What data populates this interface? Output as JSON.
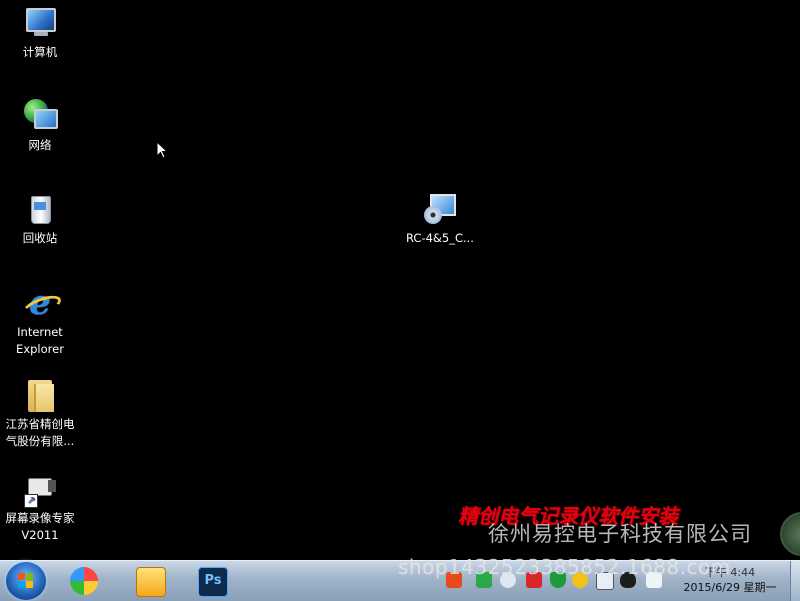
{
  "desktop": {
    "icons": [
      {
        "id": "computer",
        "label": "计算机"
      },
      {
        "id": "network",
        "label": "网络"
      },
      {
        "id": "recycle-bin",
        "label": "回收站"
      },
      {
        "id": "internet-explorer",
        "label": "Internet\nExplorer"
      },
      {
        "id": "company-folder",
        "label": "江苏省精创电\n气股份有限..."
      },
      {
        "id": "screen-recorder",
        "label": "屏幕录像专家\nV2011"
      },
      {
        "id": "installer",
        "label": "RC-4&5_C..."
      }
    ]
  },
  "overlay": {
    "promo_title": "精创电气记录仪软件安装",
    "company_watermark": "徐州易控电子科技有限公司",
    "shop_watermark": "shop1432523385852.1688.com",
    "colors": {
      "promo": "#e60012"
    }
  },
  "taskbar": {
    "start_icon": "windows-logo-icon",
    "pinned_apps": [
      "color-circle-app-icon",
      "notepad-app-icon",
      "photoshop-icon"
    ],
    "photoshop_label": "Ps",
    "tray_icons": [
      "sogou-input-icon",
      "green-app-icon",
      "chat-icon",
      "red-app-icon",
      "shield-icon",
      "add-icon",
      "network-monitor-icon",
      "qq-penguin-icon",
      "volume-icon"
    ],
    "clock": {
      "time": "下午 4:44",
      "date": "2015/6/29 星期一"
    }
  }
}
